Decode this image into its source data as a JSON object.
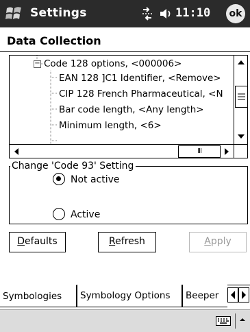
{
  "titlebar": {
    "title": "Settings",
    "time": "11:10",
    "ok_label": "ok",
    "icons": [
      "windows-start-icon",
      "connectivity-icon",
      "volume-icon"
    ]
  },
  "page": {
    "title": "Data Collection"
  },
  "tree": {
    "rows": [
      "Code 128 options, <000006>",
      "EAN 128 ]C1 Identifier, <Remove>",
      "CIP 128 French Pharmaceutical, <N",
      "Bar code length, <Any length>",
      "Minimum length, <6>"
    ],
    "expander_symbol": "−",
    "hscroll_mark": "III"
  },
  "group": {
    "legend": "Change 'Code 93' Setting",
    "options": [
      {
        "label": "Not active",
        "selected": true
      },
      {
        "label": "Active",
        "selected": false
      }
    ]
  },
  "buttons": {
    "defaults": {
      "mnemonic": "D",
      "rest": "efaults"
    },
    "refresh": {
      "mnemonic": "R",
      "rest": "efresh"
    },
    "apply": {
      "mnemonic": "A",
      "rest": "pply",
      "disabled": true
    }
  },
  "tabs": [
    {
      "label": "Symbologies",
      "active": true
    },
    {
      "label": "Symbology Options",
      "active": false
    },
    {
      "label": "Beeper",
      "active": false
    }
  ],
  "colors": {
    "titlebar_bg": "#2b2b2b",
    "cmdbar_bg": "#dcdcdc",
    "disabled_text": "#9a9a9a"
  }
}
